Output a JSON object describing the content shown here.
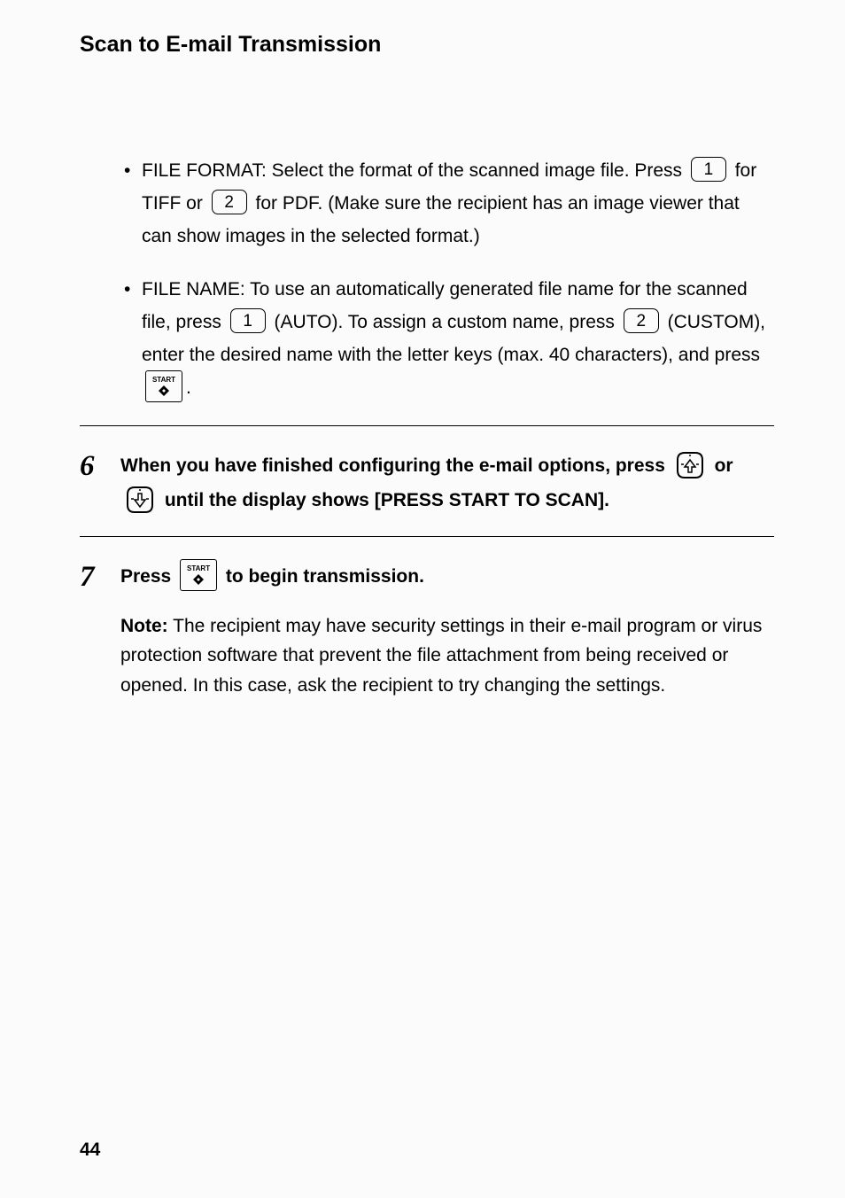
{
  "title": "Scan to E-mail Transmission",
  "bullets": {
    "fileFormat": {
      "label": "FILE FORMAT:",
      "text1": " Select the format of the scanned image file. Press ",
      "key1": "1",
      "text2": " for TIFF or ",
      "key2": "2",
      "text3": " for PDF. (Make sure the recipient has an image viewer that can show images in the selected format.)"
    },
    "fileName": {
      "label": "FILE NAME:",
      "text1": " To use an automatically generated file name for the scanned file, press ",
      "key1": "1",
      "text2": " (AUTO). To assign a custom name, press ",
      "key2": "2",
      "text3": " (CUSTOM), enter the desired name with the letter keys (max. 40 characters), and press ",
      "startLabel": "START",
      "text4": "."
    }
  },
  "step6": {
    "num": "6",
    "text1": "When you have finished configuring the e-mail options, press ",
    "text2": " or ",
    "text3": " until  the display shows [PRESS START TO SCAN]."
  },
  "step7": {
    "num": "7",
    "text1": "Press ",
    "startLabel": "START",
    "text2": " to begin transmission."
  },
  "note": {
    "label": "Note:",
    "text": " The recipient may have security settings in their e-mail program or virus protection software that prevent the file attachment from being received or opened. In this case, ask the recipient to try changing the settings."
  },
  "pageNum": "44"
}
